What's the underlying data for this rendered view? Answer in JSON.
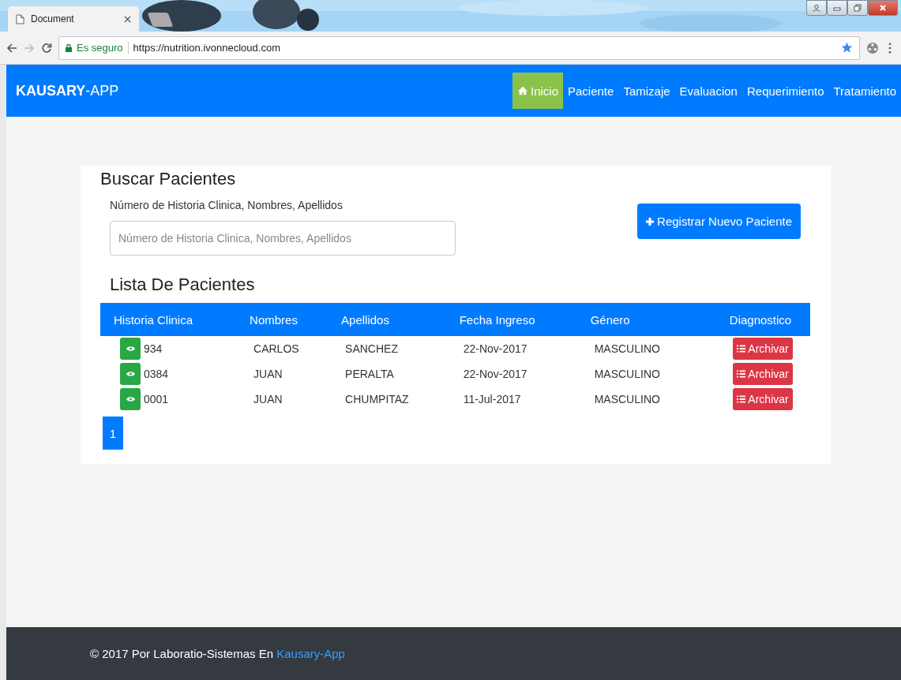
{
  "browser": {
    "tab_title": "Document",
    "security_label": "Es seguro",
    "url": "https://nutrition.ivonnecloud.com"
  },
  "navbar": {
    "brand": "**KAUSARY**-APP",
    "items": [
      {
        "label": "Inicio",
        "selected": true,
        "kind": "home"
      },
      {
        "label": "Paciente",
        "selected": false,
        "kind": "plain"
      },
      {
        "label": "Tamizaje",
        "selected": false,
        "kind": "plain"
      },
      {
        "label": "Evaluacion",
        "selected": false,
        "kind": "plain"
      },
      {
        "label": "Requerimiento",
        "selected": false,
        "kind": "plain"
      },
      {
        "label": "Tratamiento",
        "selected": false,
        "kind": "plain"
      }
    ]
  },
  "search": {
    "title": "Buscar Pacientes",
    "label": "Número de Historia Clinica, Nombres, Apellidos",
    "placeholder": "Número de Historia Clinica, Nombres, Apellidos"
  },
  "register_button": "Registrar Nuevo Paciente",
  "list_title": "Lista De Pacientes",
  "table": {
    "columns": [
      "Historia Clinica",
      "Nombres",
      "Apellidos",
      "Fecha Ingreso",
      "Género",
      "Diagnostico"
    ],
    "rows": [
      {
        "historia": "934",
        "nombres": "CARLOS",
        "apellidos": "SANCHEZ",
        "fecha": "22-Nov-2017",
        "genero": "MASCULINO",
        "action": "Archivar"
      },
      {
        "historia": "0384",
        "nombres": "JUAN",
        "apellidos": "PERALTA",
        "fecha": "22-Nov-2017",
        "genero": "MASCULINO",
        "action": "Archivar"
      },
      {
        "historia": "0001",
        "nombres": "JUAN",
        "apellidos": "CHUMPITAZ",
        "fecha": "11-Jul-2017",
        "genero": "MASCULINO",
        "action": "Archivar"
      }
    ]
  },
  "pagination": [
    {
      "label": "1",
      "selected": true
    }
  ],
  "footer": {
    "text": "© 2017 Por Laboratio-Sistemas En",
    "link": "Kausary-App"
  }
}
